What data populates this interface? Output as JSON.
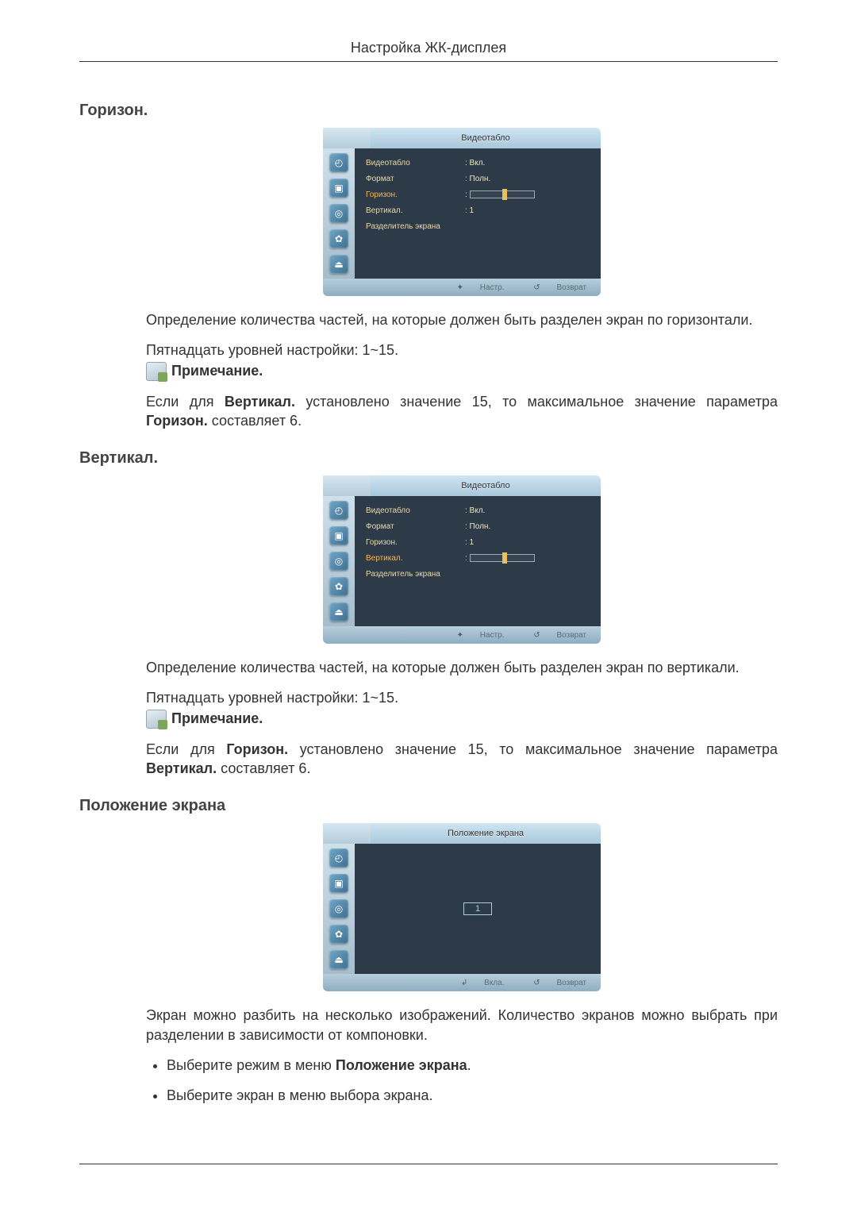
{
  "header": {
    "title": "Настройка ЖК-дисплея"
  },
  "sections": {
    "horizon": {
      "title": "Горизон.",
      "para1": "Определение количества частей, на которые должен быть разделен экран по горизонтали.",
      "para2": "Пятнадцать уровней настройки: 1~15.",
      "note_label": "Примечание.",
      "note_text_pre": "Если для ",
      "note_text_b1": "Вертикал.",
      "note_text_mid": " установлено значение 15, то максимальное значение параметра ",
      "note_text_b2": "Горизон.",
      "note_text_post": " составляет 6."
    },
    "vertical": {
      "title": "Вертикал.",
      "para1": "Определение количества частей, на которые должен быть разделен экран по вертикали.",
      "para2": "Пятнадцать уровней настройки: 1~15.",
      "note_label": "Примечание.",
      "note_text_pre": "Если для ",
      "note_text_b1": "Горизон.",
      "note_text_mid": " установлено значение 15, то максимальное значение параметра ",
      "note_text_b2": "Вертикал.",
      "note_text_post": " составляет 6."
    },
    "screenpos": {
      "title": "Положение экрана",
      "para1": "Экран можно разбить на несколько изображений. Количество экранов можно выбрать при разделении в зависимости от компоновки.",
      "bullets": [
        {
          "pre": "Выберите режим в меню ",
          "bold": "Положение экрана",
          "post": "."
        },
        {
          "pre": "Выберите экран в меню выбора экрана.",
          "bold": "",
          "post": ""
        }
      ]
    }
  },
  "osd": {
    "title1": "Видеотабло",
    "title2": "Видеотабло",
    "title3": "Положение экрана",
    "rows": {
      "video": {
        "label": "Видеотабло",
        "value": ": Вкл."
      },
      "format": {
        "label": "Формат",
        "value": ": Полн."
      },
      "horizon": {
        "label": "Горизон.",
        "value": ":"
      },
      "horizon_val": {
        "label": "Горизон.",
        "value": ": 1"
      },
      "vertical": {
        "label": "Вертикал.",
        "value": ": 1"
      },
      "vertical_sel": {
        "label": "Вертикал.",
        "value": ":"
      },
      "divider": {
        "label": "Разделитель экрана",
        "value": ""
      }
    },
    "screenpos_value": "1",
    "foot": {
      "nastr": "Настр.",
      "nastr_icon": "✦",
      "vkl": "Вкла.",
      "vkl_icon": "↲",
      "return": "Возврат",
      "return_icon": "↺"
    }
  }
}
